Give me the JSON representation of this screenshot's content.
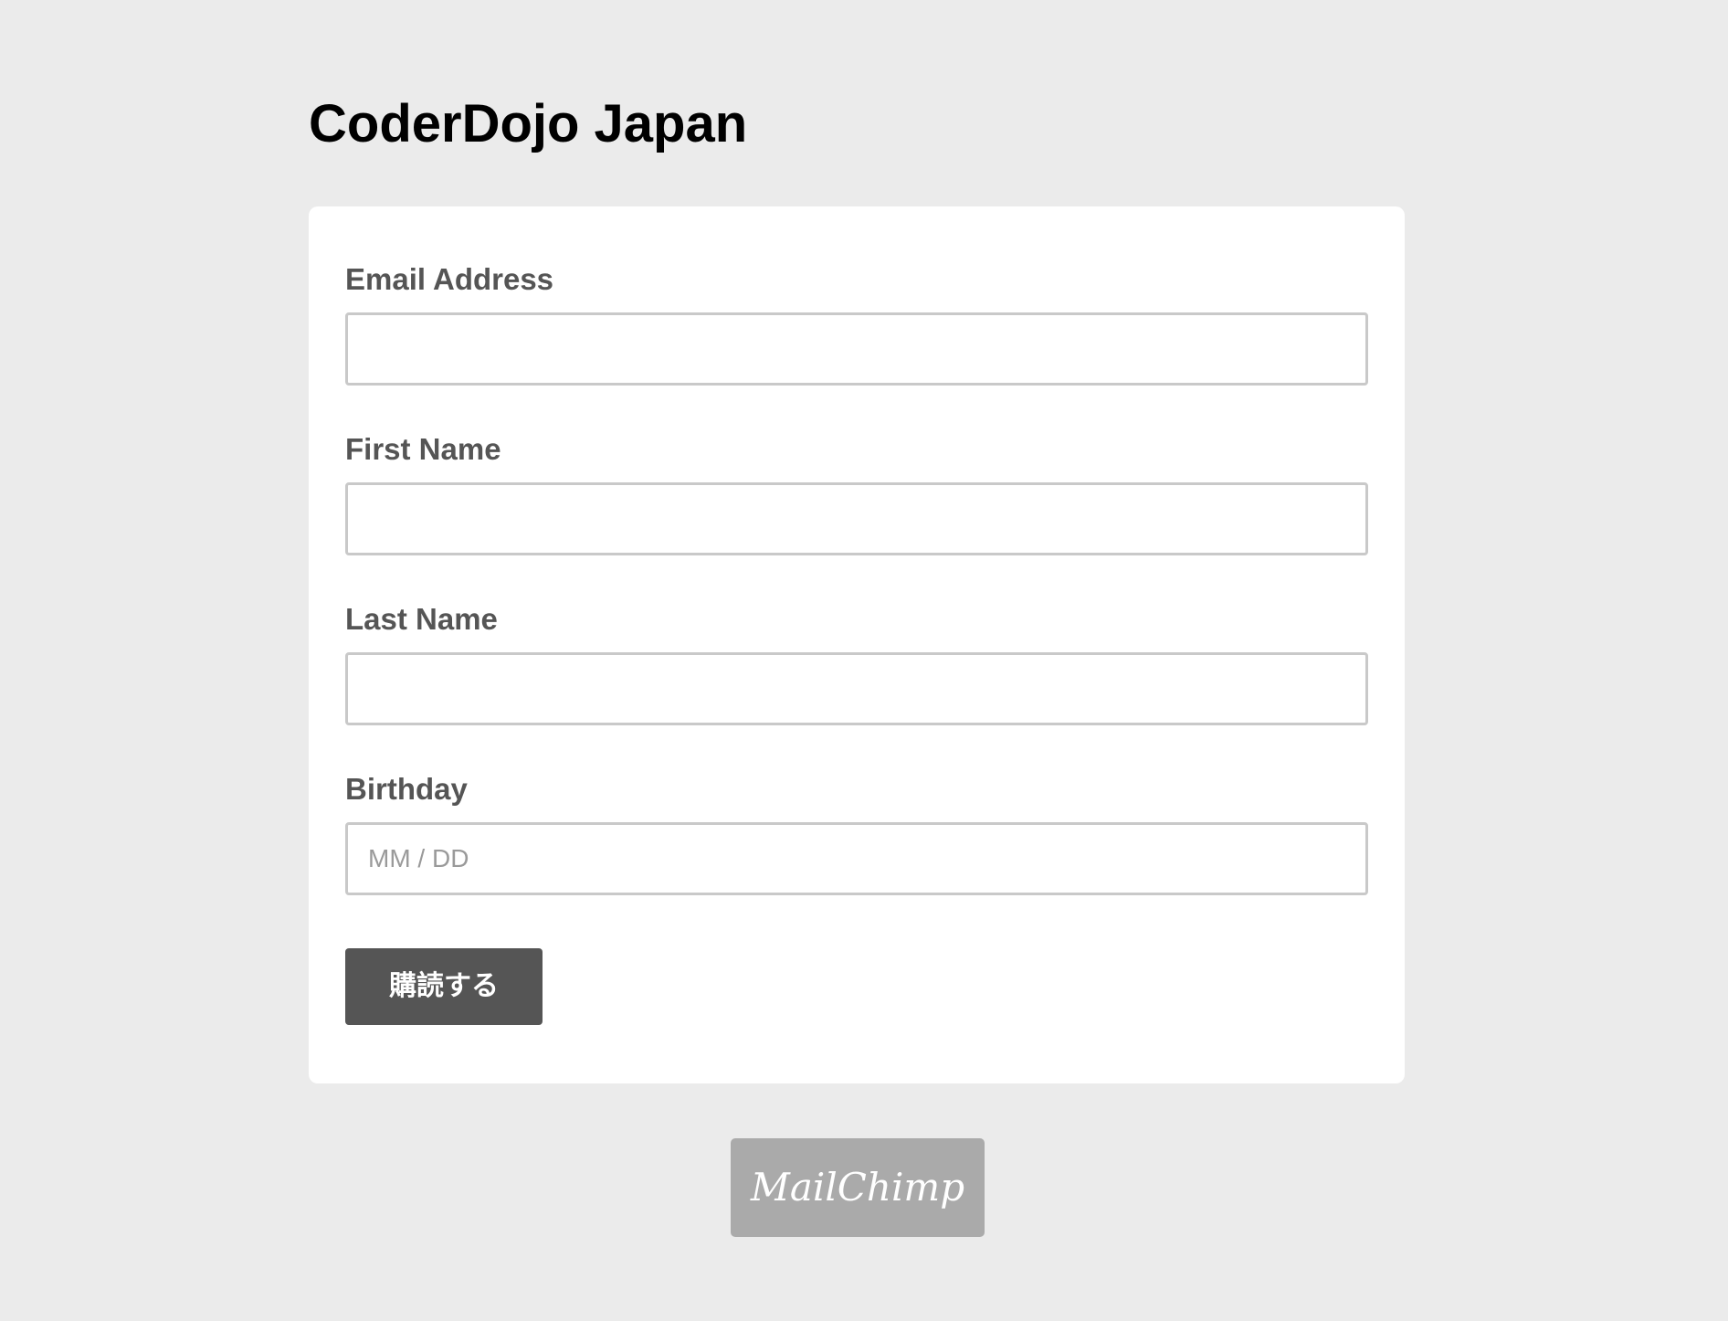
{
  "header": {
    "title": "CoderDojo Japan"
  },
  "form": {
    "fields": [
      {
        "label": "Email Address",
        "value": "",
        "placeholder": ""
      },
      {
        "label": "First Name",
        "value": "",
        "placeholder": ""
      },
      {
        "label": "Last Name",
        "value": "",
        "placeholder": ""
      },
      {
        "label": "Birthday",
        "value": "",
        "placeholder": "MM / DD"
      }
    ],
    "submit_label": "購読する"
  },
  "footer": {
    "badge_text": "MailChimp",
    "badge_icon": "mailchimp-logo-icon"
  },
  "colors": {
    "background": "#ebebeb",
    "card": "#ffffff",
    "button": "#555555",
    "label": "#555555",
    "input_border": "#c9c9c9",
    "badge": "#aaaaaa"
  }
}
